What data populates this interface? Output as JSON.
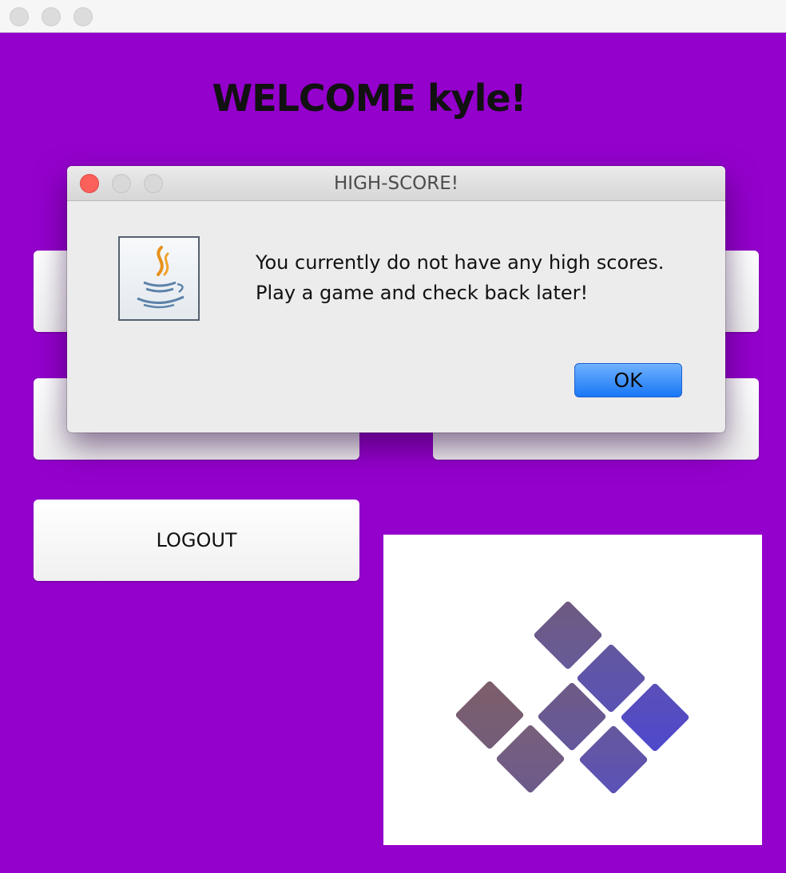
{
  "window": {
    "traffic_lights": [
      "close",
      "minimize",
      "zoom"
    ]
  },
  "main": {
    "welcome_text": "WELCOME kyle!",
    "logout_label": "LOGOUT",
    "background_color": "#9400cc"
  },
  "dialog": {
    "title": "HIGH-SCORE!",
    "message_line1": "You currently do not have any high scores.",
    "message_line2": "Play a game and check back later!",
    "ok_label": "OK",
    "icon": "java-coffee-cup-icon"
  },
  "colors": {
    "ok_button": "#1977f5",
    "close_light": "#fc605b",
    "tile_gradient_start": "#7a5e6e",
    "tile_gradient_end": "#5448c8"
  }
}
